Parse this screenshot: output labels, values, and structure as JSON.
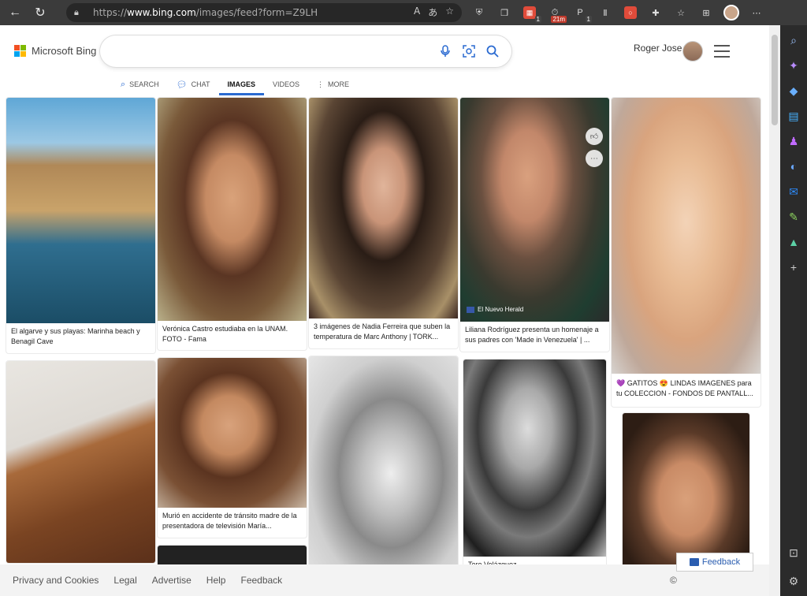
{
  "browser": {
    "url_prefix": "https://",
    "url_host": "www.bing.com",
    "url_path": "/images/feed?form=Z9LH",
    "ext_badge_1": "1",
    "ext_badge_2": "21m",
    "ext_badge_3": "1"
  },
  "header": {
    "logo_text": "Microsoft Bing",
    "search_value": "",
    "user_name": "Roger Jose"
  },
  "tabs": [
    {
      "label": "SEARCH"
    },
    {
      "label": "CHAT"
    },
    {
      "label": "IMAGES"
    },
    {
      "label": "VIDEOS"
    },
    {
      "label": "MORE"
    }
  ],
  "cards": [
    {
      "caption": "El algarve y sus playas: Marinha beach y Benagil Cave"
    },
    {
      "caption": "Verónica Castro estudiaba en la UNAM. FOTO - Fama"
    },
    {
      "caption": "3 imágenes de Nadia Ferreira que suben la temperatura de Marc Anthony | TORK..."
    },
    {
      "caption": "Liliana Rodríguez presenta un homenaje a sus padres con 'Made in Venezuela' | ...",
      "source": "El Nuevo Herald"
    },
    {
      "caption": "💜 GATITOS 😍 LINDAS IMAGENES para tu COLECCION - FONDOS DE PANTALL..."
    },
    {
      "caption": ""
    },
    {
      "caption": "Murió en accidente de tránsito madre de la presentadora de televisión María..."
    },
    {
      "caption": ""
    },
    {
      "caption": "Tere Velázquez"
    },
    {
      "caption": ""
    },
    {
      "caption": ""
    }
  ],
  "footer": {
    "links": [
      "Privacy and Cookies",
      "Legal",
      "Advertise",
      "Help",
      "Feedback"
    ],
    "copyright": "©",
    "feedback_button": "Feedback"
  },
  "colors": {
    "accent": "#2a6ad1",
    "chrome": "#3b3b3b"
  }
}
